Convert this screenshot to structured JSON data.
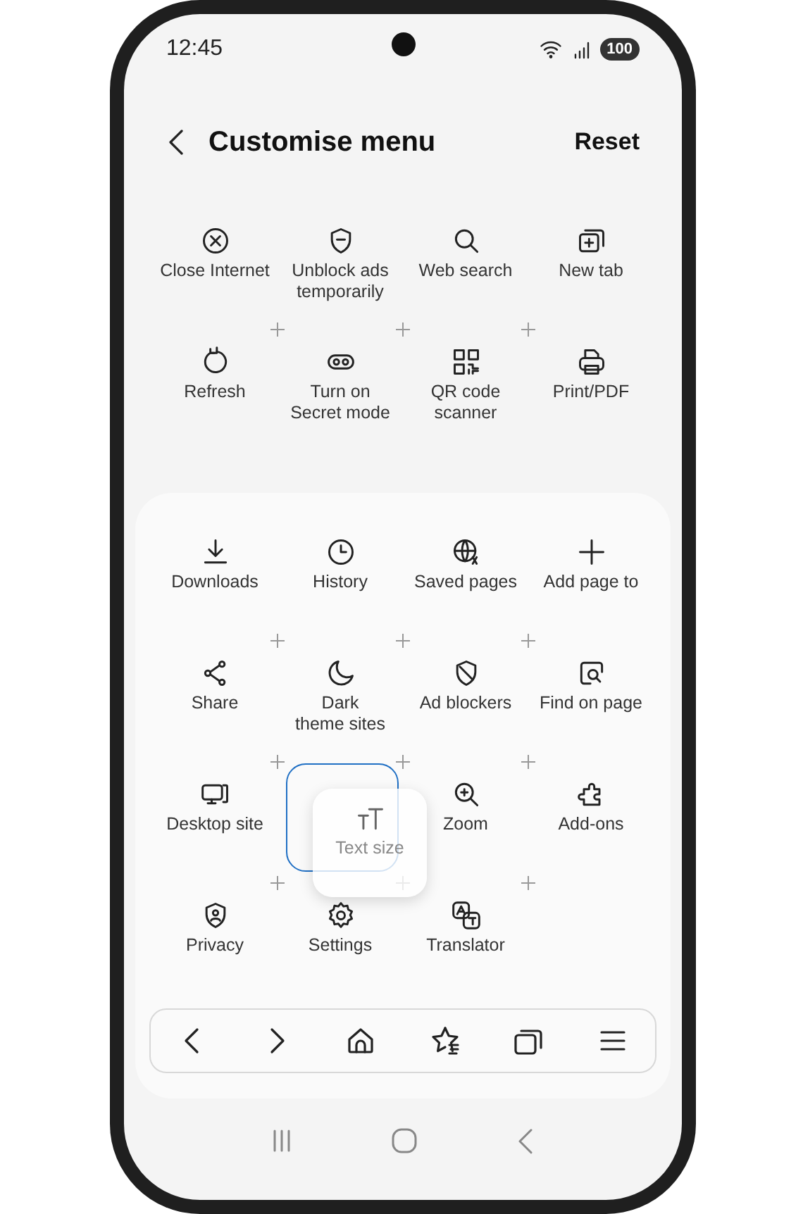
{
  "status_bar": {
    "time": "12:45",
    "battery": "100"
  },
  "header": {
    "title": "Customise menu",
    "action": "Reset"
  },
  "available_items": [
    {
      "label": "Close Internet"
    },
    {
      "label": "Unblock ads temporarily"
    },
    {
      "label": "Web search"
    },
    {
      "label": "New tab"
    },
    {
      "label": "Refresh"
    },
    {
      "label": "Turn on Secret mode"
    },
    {
      "label": "QR code scanner"
    },
    {
      "label": "Print/PDF"
    }
  ],
  "menu_items": [
    {
      "kind": "item",
      "label": "Downloads"
    },
    {
      "kind": "item",
      "label": "History"
    },
    {
      "kind": "item",
      "label": "Saved pages"
    },
    {
      "kind": "item",
      "label": "Add page to"
    },
    {
      "kind": "item",
      "label": "Share"
    },
    {
      "kind": "item",
      "label": "Dark theme sites"
    },
    {
      "kind": "item",
      "label": "Ad blockers"
    },
    {
      "kind": "item",
      "label": "Find on page"
    },
    {
      "kind": "item",
      "label": "Desktop site"
    },
    {
      "kind": "slot",
      "dragged": {
        "label": "Text size"
      }
    },
    {
      "kind": "item",
      "label": "Zoom"
    },
    {
      "kind": "item",
      "label": "Add-ons"
    },
    {
      "kind": "item",
      "label": "Privacy"
    },
    {
      "kind": "item",
      "label": "Settings"
    },
    {
      "kind": "item",
      "label": "Translator"
    }
  ]
}
